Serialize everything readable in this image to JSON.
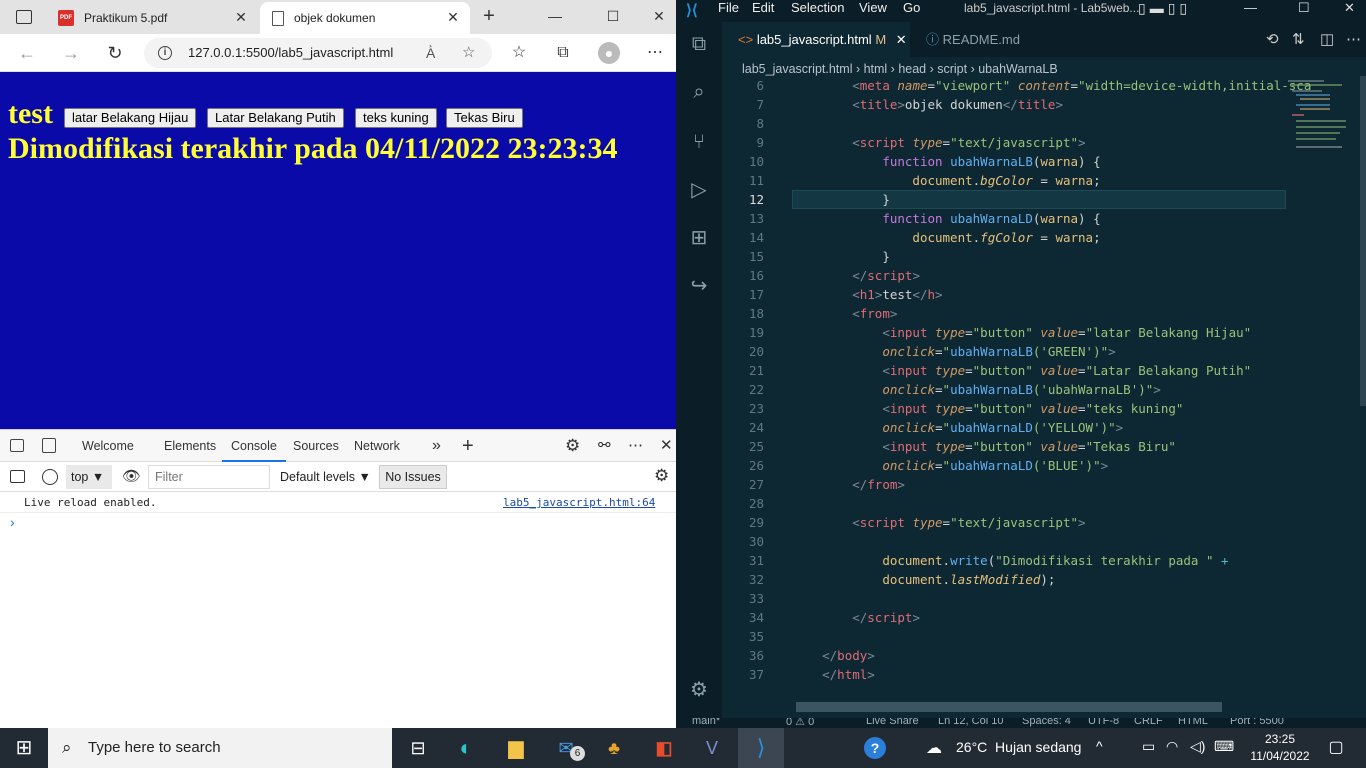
{
  "browser": {
    "tabs": [
      {
        "title": "Praktikum 5.pdf"
      },
      {
        "title": "objek dokumen"
      }
    ],
    "url": "127.0.0.1:5500/lab5_javascript.html",
    "page": {
      "heading": "test",
      "buttons": [
        "latar Belakang Hijau",
        "Latar Belakang Putih",
        "teks kuning",
        "Tekas Biru"
      ],
      "modified_text": "Dimodifikasi terakhir pada 04/11/2022 23:23:34",
      "bg_color": "#0a0aa8",
      "fg_color": "#ffff33"
    },
    "devtools": {
      "tabs": [
        "Welcome",
        "Elements",
        "Console",
        "Sources",
        "Network"
      ],
      "active_tab": "Console",
      "context": "top",
      "filter_placeholder": "Filter",
      "levels": "Default levels",
      "issues": "No Issues",
      "message": "Live reload enabled.",
      "message_source": "lab5_javascript.html:64"
    }
  },
  "vscode": {
    "menu": [
      "File",
      "Edit",
      "Selection",
      "View",
      "Go"
    ],
    "title": "lab5_javascript.html - Lab5web...",
    "tabs": [
      {
        "label": "lab5_javascript.html",
        "status": "M"
      },
      {
        "label": "README.md"
      }
    ],
    "breadcrumb": [
      "lab5_javascript.html",
      "html",
      "head",
      "script",
      "ubahWarnaLB"
    ],
    "line_numbers": [
      "6",
      "7",
      "8",
      "9",
      "10",
      "11",
      "12",
      "13",
      "14",
      "15",
      "16",
      "17",
      "18",
      "19",
      "20",
      "21",
      "22",
      "23",
      "24",
      "25",
      "26",
      "27",
      "28",
      "29",
      "30",
      "31",
      "32",
      "33",
      "34",
      "35",
      "36",
      "37"
    ],
    "current_line": "12",
    "status": {
      "branch": "main*",
      "problems": "0 ⚠ 0",
      "live_share": "Live Share",
      "position": "Ln 12, Col 10",
      "spaces": "Spaces: 4",
      "encoding": "UTF-8",
      "eol": "CRLF",
      "language": "HTML",
      "port": "Port : 5500"
    }
  },
  "taskbar": {
    "search_placeholder": "Type here to search",
    "mail_badge": "6",
    "weather": "26°C  Hujan sedang",
    "time": "23:25",
    "date": "11/04/2022"
  }
}
